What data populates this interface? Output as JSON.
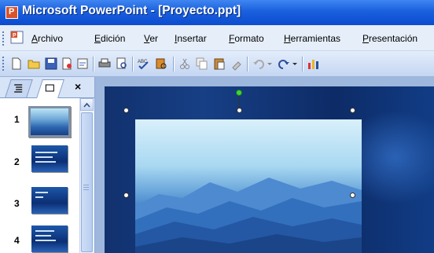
{
  "window": {
    "title": "Microsoft PowerPoint - [Proyecto.ppt]"
  },
  "menubar": {
    "items": [
      {
        "underline": "A",
        "rest": "rchivo"
      },
      {
        "underline": "E",
        "rest": "dición"
      },
      {
        "underline": "V",
        "rest": "er"
      },
      {
        "underline": "I",
        "rest": "nsertar"
      },
      {
        "underline": "F",
        "rest": "ormato"
      },
      {
        "underline": "H",
        "rest": "erramientas"
      },
      {
        "underline": "P",
        "rest": "resentación"
      }
    ]
  },
  "toolbar": {
    "buttons": [
      "new-icon",
      "open-icon",
      "save-icon",
      "permission-icon",
      "publish-icon",
      "print-icon",
      "print-preview-icon",
      "spelling-icon",
      "research-icon",
      "cut-icon",
      "copy-icon",
      "paste-icon",
      "format-painter-icon",
      "undo-icon",
      "undo-dropdown-icon",
      "redo-icon",
      "redo-dropdown-icon",
      "chart-icon"
    ]
  },
  "panel": {
    "close_label": "×",
    "slides": [
      "1",
      "2",
      "3",
      "4"
    ]
  },
  "colors": {
    "titlebar": "#1a5fdd",
    "menubar": "#e6eef9",
    "slide_bg": "#173f85"
  }
}
